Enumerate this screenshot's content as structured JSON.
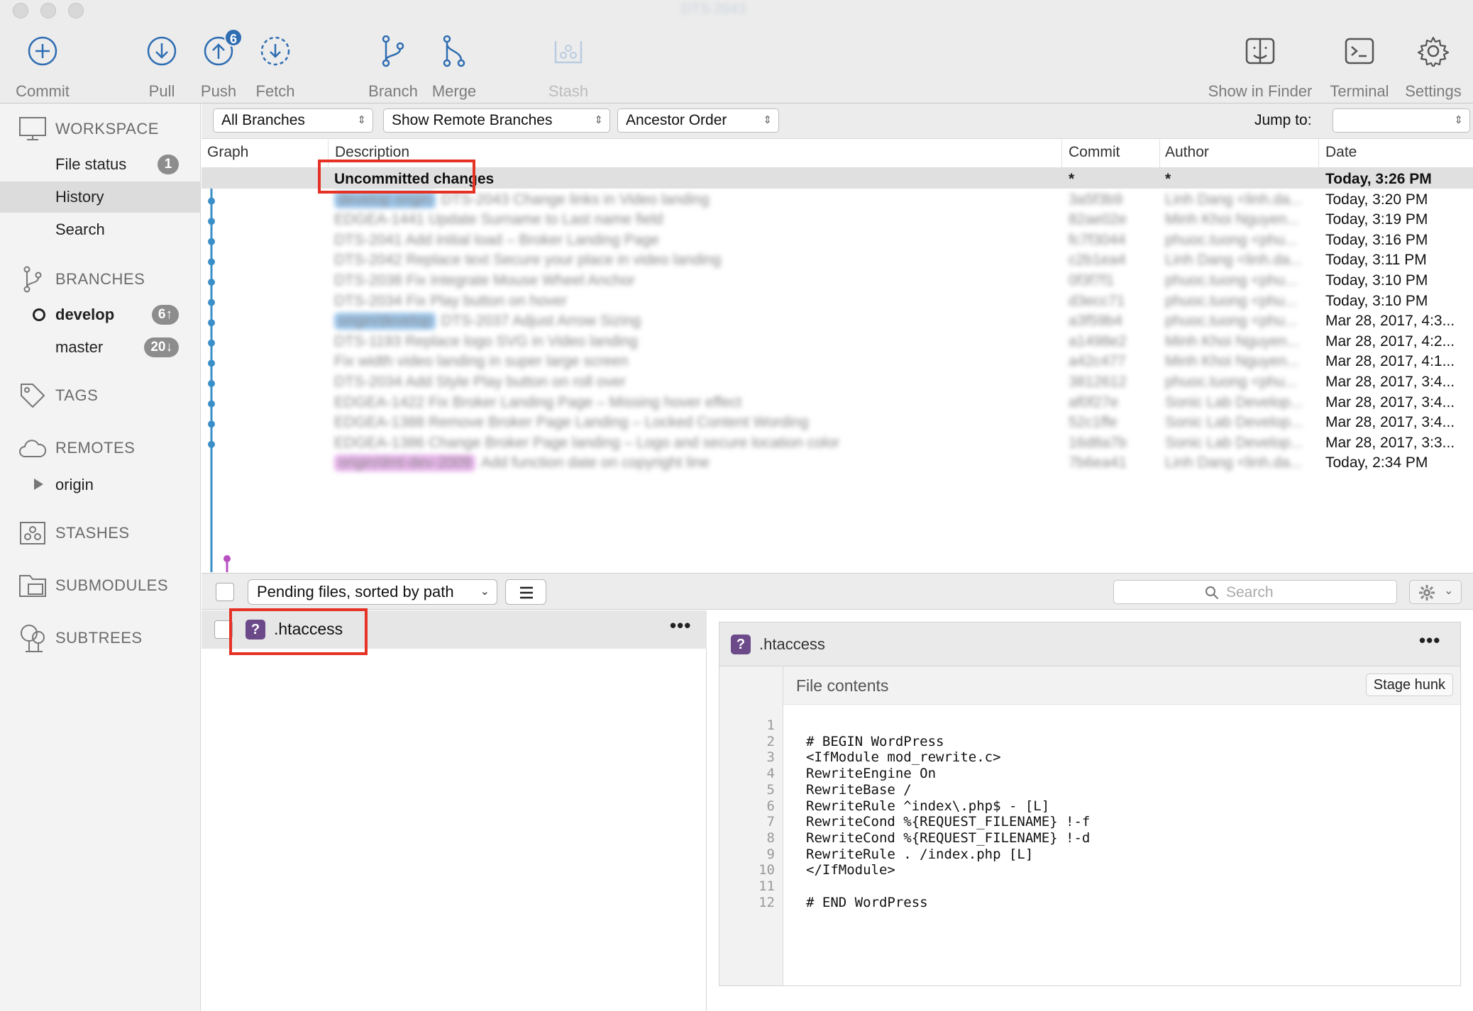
{
  "window": {
    "title": "DTS-2043"
  },
  "toolbar": {
    "commit": "Commit",
    "pull": "Pull",
    "push": "Push",
    "push_badge": "6",
    "fetch": "Fetch",
    "branch": "Branch",
    "merge": "Merge",
    "stash": "Stash",
    "finder": "Show in Finder",
    "terminal": "Terminal",
    "settings": "Settings"
  },
  "sidebar": {
    "workspace": "WORKSPACE",
    "file_status": "File status",
    "file_status_count": "1",
    "history": "History",
    "search": "Search",
    "branches": "BRANCHES",
    "develop": "develop",
    "develop_badge": "6↑",
    "master": "master",
    "master_badge": "20↓",
    "tags": "TAGS",
    "remotes": "REMOTES",
    "origin": "origin",
    "stashes": "STASHES",
    "submodules": "SUBMODULES",
    "subtrees": "SUBTREES"
  },
  "filters": {
    "branches": "All Branches",
    "remote": "Show Remote Branches",
    "order": "Ancestor Order",
    "jump": "Jump to:"
  },
  "columns": {
    "graph": "Graph",
    "description": "Description",
    "commit": "Commit",
    "author": "Author",
    "date": "Date"
  },
  "rows": [
    {
      "desc": "Uncommitted changes",
      "commit": "*",
      "author": "*",
      "date": "Today, 3:26 PM"
    },
    {
      "tag": "develop  origin",
      "desc": "DTS-2043 Change links in Video landing",
      "commit": "3a5f3b9",
      "author": "Linh Dang <linh.da...",
      "date": "Today, 3:20 PM"
    },
    {
      "desc": "EDGEA-1441 Update Surname to Last name field",
      "commit": "82ae02e",
      "author": "Minh Khoi Nguyen...",
      "date": "Today, 3:19 PM"
    },
    {
      "desc": "DTS-2041 Add initial load – Broker Landing Page",
      "commit": "fc7f3044",
      "author": "phuoc.tuong <phu...",
      "date": "Today, 3:16 PM"
    },
    {
      "desc": "DTS-2042 Replace text Secure your place in video landing",
      "commit": "c2b1ea4",
      "author": "Linh Dang <linh.da...",
      "date": "Today, 3:11 PM"
    },
    {
      "desc": "DTS-2038 Fix Integrate Mouse Wheel Anchor",
      "commit": "0f3f7f1",
      "author": "phuoc.tuong <phu...",
      "date": "Today, 3:10 PM"
    },
    {
      "desc": "DTS-2034 Fix Play button on hover",
      "commit": "d3ecc71",
      "author": "phuoc.tuong <phu...",
      "date": "Today, 3:10 PM"
    },
    {
      "tag": "origin/develop",
      "desc": "DTS-2037 Adjust Arrow Sizing",
      "commit": "a3f59b4",
      "author": "phuoc.tuong <phu...",
      "date": "Mar 28, 2017, 4:3..."
    },
    {
      "desc": "DTS-1193 Replace logo SVG in Video landing",
      "commit": "a1498e2",
      "author": "Minh Khoi Nguyen...",
      "date": "Mar 28, 2017, 4:2..."
    },
    {
      "desc": "Fix width video landing in super large screen",
      "commit": "a42c477",
      "author": "Minh Khoi Nguyen...",
      "date": "Mar 28, 2017, 4:1..."
    },
    {
      "desc": "DTS-2034 Add Style Play button on roll over",
      "commit": "3812612",
      "author": "phuoc.tuong <phu...",
      "date": "Mar 28, 2017, 3:4..."
    },
    {
      "desc": "EDGEA-1422 Fix Broker Landing Page – Missing hover effect",
      "commit": "af0f27e",
      "author": "Sonic Lab Develop...",
      "date": "Mar 28, 2017, 3:4..."
    },
    {
      "desc": "EDGEA-1388 Remove Broker Page Landing – Locked Content Wording",
      "commit": "52c1ffe",
      "author": "Sonic Lab Develop...",
      "date": "Mar 28, 2017, 3:4..."
    },
    {
      "desc": "EDGEA-1386 Change Broker Page landing – Logo and secure location color",
      "commit": "16d8a7b",
      "author": "Sonic Lab Develop...",
      "date": "Mar 28, 2017, 3:3..."
    },
    {
      "tag": "origin/dmt-dev-2009",
      "desc": "Add function date on copyright line",
      "commit": "7b6ea41",
      "author": "Linh Dang <linh.da...",
      "date": "Today, 2:34 PM"
    }
  ],
  "bottom": {
    "pending": "Pending files, sorted by path",
    "search_placeholder": "Search"
  },
  "file": {
    "name": ".htaccess",
    "icon": "?"
  },
  "diff": {
    "name": ".htaccess",
    "section": "File contents",
    "stage": "Stage hunk",
    "line_numbers": [
      "1",
      "2",
      "3",
      "4",
      "5",
      "6",
      "7",
      "8",
      "9",
      "10",
      "11",
      "12"
    ],
    "lines": [
      "",
      "# BEGIN WordPress",
      "<IfModule mod_rewrite.c>",
      "RewriteEngine On",
      "RewriteBase /",
      "RewriteRule ^index\\.php$ - [L]",
      "RewriteCond %{REQUEST_FILENAME} !-f",
      "RewriteCond %{REQUEST_FILENAME} !-d",
      "RewriteRule . /index.php [L]",
      "</IfModule>",
      "",
      "# END WordPress"
    ]
  },
  "colors": {
    "accent": "#2e6db2",
    "highlight": "#e53224",
    "graph_line": "#3a8fc8",
    "graph_alt": "#b94fc1",
    "file_icon": "#6c4a8a"
  }
}
